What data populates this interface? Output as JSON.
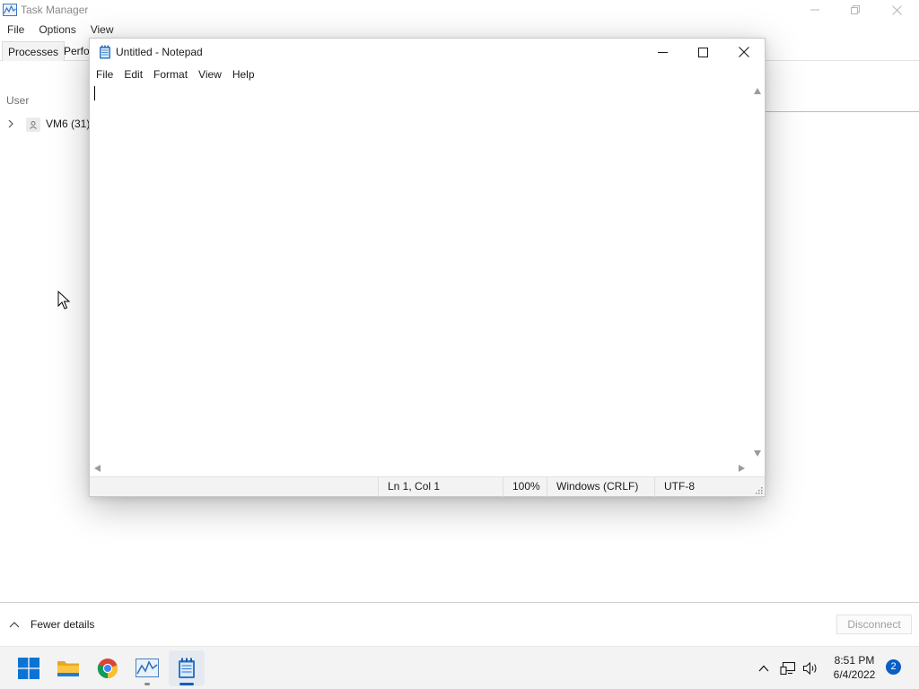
{
  "colors": {
    "accent": "#0a5fc4",
    "notepad_icon": "#2f78c9",
    "taskbar_bg": "#f3f3f3"
  },
  "task_manager": {
    "title": "Task Manager",
    "menu": [
      "File",
      "Options",
      "View"
    ],
    "tabs": [
      "Processes",
      "Perfo"
    ],
    "column_header": "User",
    "rows": [
      {
        "label": "VM6 (31)",
        "icon": "user-icon"
      }
    ],
    "footer": {
      "fewer_details": "Fewer details",
      "disconnect": "Disconnect"
    }
  },
  "notepad": {
    "title": "Untitled - Notepad",
    "menu": [
      "File",
      "Edit",
      "Format",
      "View",
      "Help"
    ],
    "content": "",
    "status": {
      "position": "Ln 1, Col 1",
      "zoom": "100%",
      "line_endings": "Windows (CRLF)",
      "encoding": "UTF-8"
    }
  },
  "taskbar": {
    "apps": [
      {
        "name": "Start",
        "icon": "windows-start-icon"
      },
      {
        "name": "File Explorer",
        "icon": "folder-icon"
      },
      {
        "name": "Google Chrome",
        "icon": "chrome-icon"
      },
      {
        "name": "Task Manager",
        "icon": "task-manager-icon",
        "running": true
      },
      {
        "name": "Notepad",
        "icon": "notepad-icon",
        "running": true,
        "active": true
      }
    ],
    "tray": {
      "time": "8:51 PM",
      "date": "6/4/2022",
      "notifications": "2"
    }
  }
}
